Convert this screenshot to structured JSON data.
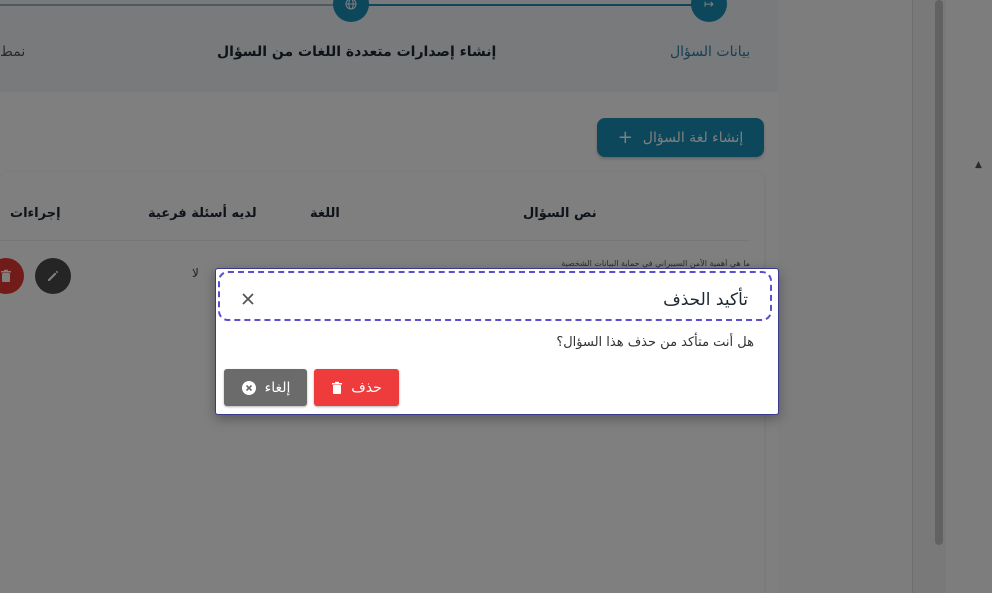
{
  "stepper": {
    "step1_label": "بيانات السؤال",
    "step2_label": "إنشاء إصدارات متعددة اللغات من السؤال",
    "step3_label": "نمط"
  },
  "toolbar": {
    "create_label": "إنشاء لغة السؤال",
    "create_icon": "plus-icon"
  },
  "table": {
    "headers": [
      "نص السؤال",
      "اللغة",
      "لديه أسئلة فرعية",
      "إجراءات"
    ],
    "rows": [
      {
        "question_text": "ما هي أهمية الأمن السيبراني في حماية البيانات الشخصية",
        "has_sub_questions": "لا"
      }
    ]
  },
  "dialog": {
    "title": "تأكيد الحذف",
    "message": "هل أنت متأكد من حذف هذا السؤال؟",
    "delete_label": "حذف",
    "cancel_label": "إلغاء"
  },
  "colors": {
    "primary": "#1a8fb8",
    "danger": "#ee3b3b",
    "neutral": "#6b6b6b",
    "focus_outline": "#5a4fcf"
  }
}
